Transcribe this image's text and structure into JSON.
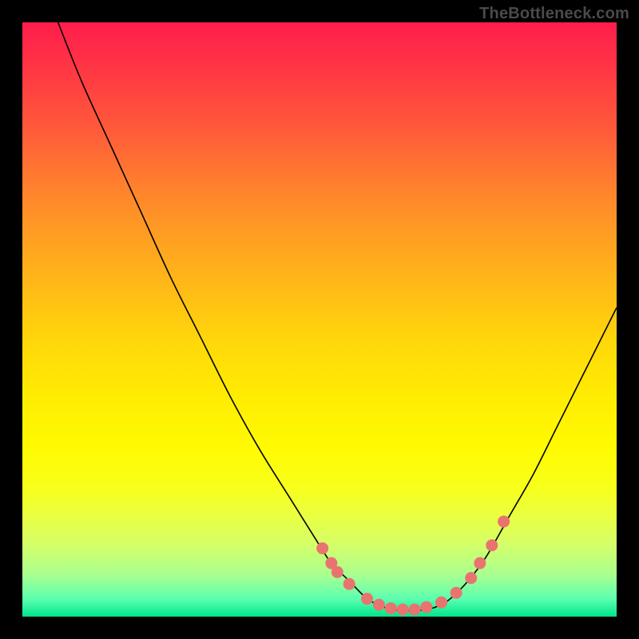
{
  "watermark": "TheBottleneck.com",
  "chart_data": {
    "type": "line",
    "title": "",
    "xlabel": "",
    "ylabel": "",
    "xlim": [
      0,
      100
    ],
    "ylim": [
      0,
      100
    ],
    "curve": {
      "name": "bottleneck-curve",
      "x": [
        6,
        10,
        15,
        20,
        25,
        30,
        35,
        40,
        45,
        50,
        52,
        55,
        58,
        60,
        62,
        65,
        68,
        70,
        72,
        75,
        78,
        82,
        86,
        90,
        94,
        98,
        100
      ],
      "y": [
        100,
        90,
        79,
        68,
        57,
        47,
        37,
        28,
        20,
        12,
        9,
        6,
        3,
        2,
        1.2,
        1,
        1.2,
        1.8,
        3,
        6,
        10,
        17,
        24,
        32,
        40,
        48,
        52
      ]
    },
    "markers": {
      "name": "highlight-dots",
      "x": [
        50.5,
        52,
        53,
        55,
        58,
        60,
        62,
        64,
        66,
        68,
        70.5,
        73,
        75.5,
        77,
        79,
        81
      ],
      "y": [
        11.5,
        9,
        7.5,
        5.5,
        3,
        2,
        1.4,
        1.2,
        1.2,
        1.6,
        2.4,
        4,
        6.5,
        9,
        12,
        16
      ]
    },
    "gradient_colors": {
      "top": "#ff1e4c",
      "mid": "#ffee02",
      "bottom": "#00e58a"
    }
  }
}
